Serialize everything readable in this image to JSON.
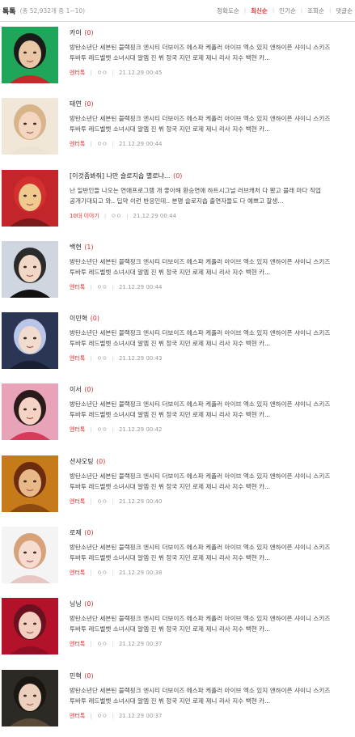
{
  "header": {
    "title": "톡톡",
    "count": "(총 52,932개 중 1~10)",
    "sorts": [
      "정확도순",
      "최신순",
      "인기순",
      "조회순",
      "댓글순"
    ],
    "active_sort": "최신순"
  },
  "colors": {
    "accent": "#dd3333",
    "muted": "#999999"
  },
  "items": [
    {
      "title": "카이",
      "comments": "(0)",
      "snippet": "방탄소년단 세븐틴 블랙핑크 엔시티 더보이즈 에스파 케플러 아이브 엑소 있지 엔하이픈 샤이니 스키즈 투바투 레드벨벳 소녀시대 알엠 진 뷔 정국 지민 로제 제니 리사 지수 백현 카...",
      "category": "엔터톡",
      "author": "ㅇㅇ",
      "date": "21.12.29 00:45",
      "thumb": "green"
    },
    {
      "title": "태연",
      "comments": "(0)",
      "snippet": "방탄소년단 세븐틴 블랙핑크 엔시티 더보이즈 에스파 케플러 아이브 엑소 있지 엔하이픈 샤이니 스키즈 투바투 레드벨벳 소녀시대 알엠 진 뷔 정국 지민 로제 제니 리사 지수 백현 카...",
      "category": "엔터톡",
      "author": "ㅇㅇ",
      "date": "21.12.29 00:44",
      "thumb": "cream"
    },
    {
      "title": "[이것좀봐줘] 나만 슬로지숍 별로냐...",
      "comments": "(0)",
      "snippet": "난 일반인들 나오는 연애프로그램 개 좋아해 환승연애 하트시그널 러브캐처 다 봤고 블래 마다 직업 공개기대되고 와.. 딥약 이런 반응인데.. 분명 슬로지숍 출연자들도 다 예쁘고 잘생...",
      "category": "10대 이야기",
      "author": "ㅇㅇ",
      "date": "21.12.29 00:44",
      "thumb": "red"
    },
    {
      "title": "백현",
      "comments": "(1)",
      "snippet": "방탄소년단 세븐틴 블랙핑크 엔시티 더보이즈 에스파 케플러 아이브 엑소 있지 엔하이픈 샤이니 스키즈 투바투 레드벨벳 소녀시대 알엠 진 뷔 정국 지민 로제 제니 리사 지수 백현 카...",
      "category": "엔터톡",
      "author": "ㅇㅇ",
      "date": "21.12.29 00:44",
      "thumb": "grey"
    },
    {
      "title": "이민혁",
      "comments": "(0)",
      "snippet": "방탄소년단 세븐틴 블랙핑크 엔시티 더보이즈 에스파 케플러 아이브 엑소 있지 엔하이픈 샤이니 스키즈 투바투 레드벨벳 소녀시대 알엠 진 뷔 정국 지민 로제 제니 리사 지수 백현 카...",
      "category": "엔터톡",
      "author": "ㅇㅇ",
      "date": "21.12.29 00:43",
      "thumb": "navy"
    },
    {
      "title": "이서",
      "comments": "(0)",
      "snippet": "방탄소년단 세븐틴 블랙핑크 엔시티 더보이즈 에스파 케플러 아이브 엑소 있지 엔하이픈 샤이니 스키즈 투바투 레드벨벳 소녀시대 알엠 진 뷔 정국 지민 로제 제니 리사 지수 백현 카...",
      "category": "엔터톡",
      "author": "ㅇㅇ",
      "date": "21.12.29 00:42",
      "thumb": "pink"
    },
    {
      "title": "션샤오팅",
      "comments": "(0)",
      "snippet": "방탄소년단 세븐틴 블랙핑크 엔시티 더보이즈 에스파 케플러 아이브 엑소 있지 엔하이픈 샤이니 스키즈 투바투 레드벨벳 소녀시대 알엠 진 뷔 정국 지민 로제 제니 리사 지수 백현 카...",
      "category": "엔터톡",
      "author": "ㅇㅇ",
      "date": "21.12.29 00:40",
      "thumb": "amber"
    },
    {
      "title": "로제",
      "comments": "(0)",
      "snippet": "방탄소년단 세븐틴 블랙핑크 엔시티 더보이즈 에스파 케플러 아이브 엑소 있지 엔하이픈 샤이니 스키즈 투바투 레드벨벳 소녀시대 알엠 진 뷔 정국 지민 로제 제니 리사 지수 백현 카...",
      "category": "엔터톡",
      "author": "ㅇㅇ",
      "date": "21.12.29 00:38",
      "thumb": "white"
    },
    {
      "title": "닝닝",
      "comments": "(0)",
      "snippet": "방탄소년단 세븐틴 블랙핑크 엔시티 더보이즈 에스파 케플러 아이브 엑소 있지 엔하이픈 샤이니 스키즈 투바투 레드벨벳 소녀시대 알엠 진 뷔 정국 지민 로제 제니 리사 지수 백현 카...",
      "category": "엔터톡",
      "author": "ㅇㅇ",
      "date": "21.12.29 00:37",
      "thumb": "crimson"
    },
    {
      "title": "민혁",
      "comments": "(0)",
      "snippet": "방탄소년단 세븐틴 블랙핑크 엔시티 더보이즈 에스파 케플러 아이브 엑소 있지 엔하이픈 샤이니 스키즈 투바투 레드벨벳 소녀시대 알엠 진 뷔 정국 지민 로제 제니 리사 지수 백현 카...",
      "category": "엔터톡",
      "author": "ㅇㅇ",
      "date": "21.12.29 00:37",
      "thumb": "dark"
    }
  ]
}
